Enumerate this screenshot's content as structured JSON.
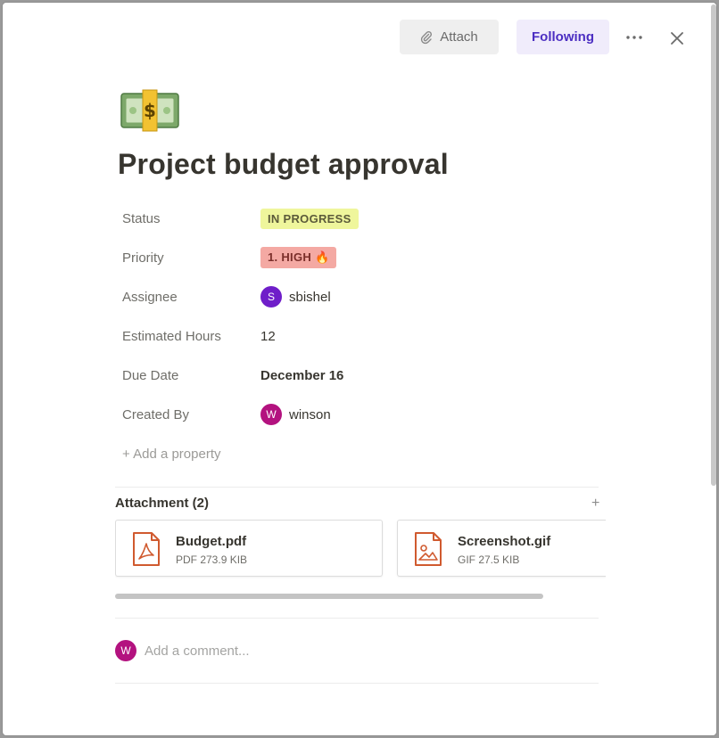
{
  "colors": {
    "accent": "#4c2fc2",
    "following_bg": "#f0ecfb",
    "status_bg": "#eff69c",
    "priority_bg": "#f4a9a3",
    "avatar_s": "#6f1ec9",
    "avatar_w": "#b3127f",
    "file_icon": "#d05a2f"
  },
  "toolbar": {
    "attach_label": "Attach",
    "attach_icon": "paperclip-icon",
    "following_label": "Following",
    "more_icon": "more-horizontal-icon",
    "close_icon": "close-icon"
  },
  "page": {
    "icon": "money-bill-icon",
    "title": "Project budget approval"
  },
  "properties": {
    "status": {
      "label": "Status",
      "value": "IN PROGRESS"
    },
    "priority": {
      "label": "Priority",
      "value": "1. HIGH 🔥"
    },
    "assignee": {
      "label": "Assignee",
      "avatar_letter": "S",
      "value": "sbishel"
    },
    "estimated_hours": {
      "label": "Estimated Hours",
      "value": "12"
    },
    "due_date": {
      "label": "Due Date",
      "value": "December 16"
    },
    "created_by": {
      "label": "Created By",
      "avatar_letter": "W",
      "value": "winson"
    }
  },
  "add_property_label": "+ Add a property",
  "attachments": {
    "header": "Attachment (2)",
    "add_label": "+",
    "files": [
      {
        "name": "Budget.pdf",
        "meta": "PDF 273.9 KIB",
        "icon": "pdf-file-icon"
      },
      {
        "name": "Screenshot.gif",
        "meta": "GIF 27.5 KIB",
        "icon": "image-file-icon"
      }
    ]
  },
  "comment": {
    "avatar_letter": "W",
    "placeholder": "Add a comment..."
  }
}
